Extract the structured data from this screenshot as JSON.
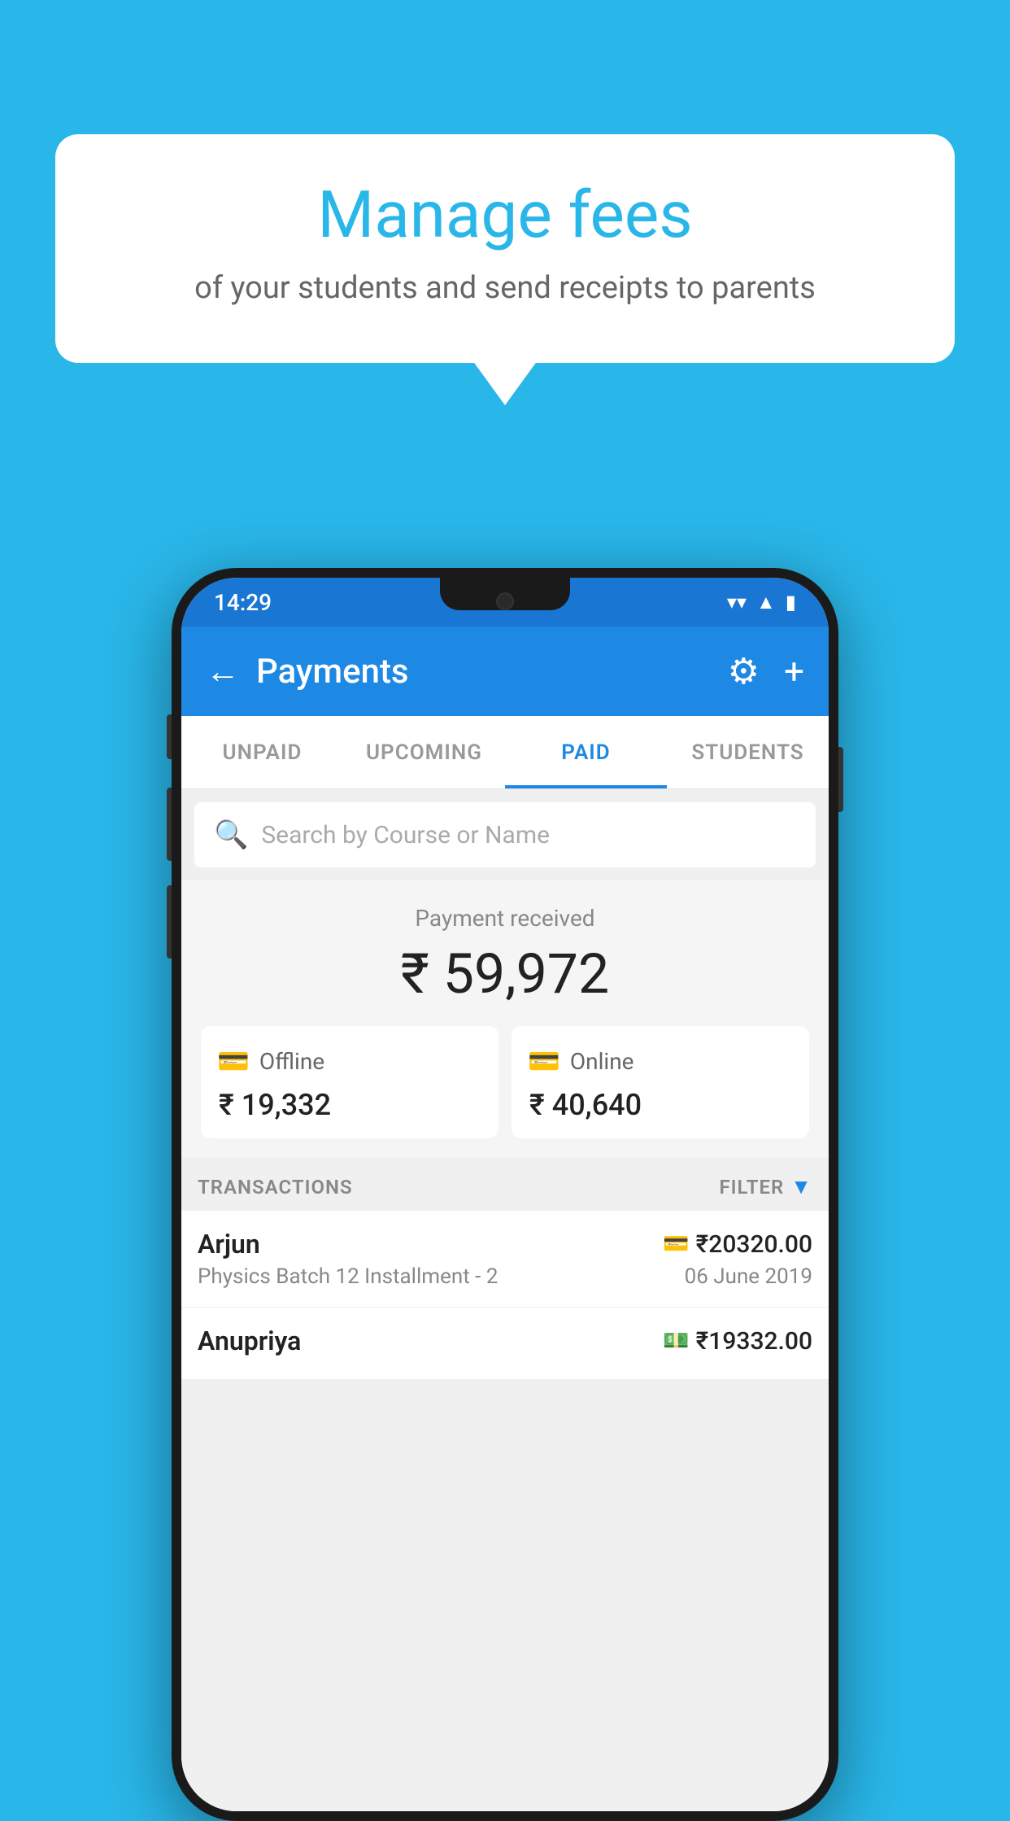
{
  "page": {
    "background_color": "#29b6e8"
  },
  "bubble": {
    "title": "Manage fees",
    "subtitle": "of your students and send receipts to parents"
  },
  "status_bar": {
    "time": "14:29",
    "wifi_icon": "▼",
    "signal_icon": "▲",
    "battery_icon": "▮"
  },
  "header": {
    "title": "Payments",
    "back_label": "←",
    "gear_label": "⚙",
    "plus_label": "+"
  },
  "tabs": [
    {
      "id": "unpaid",
      "label": "UNPAID",
      "active": false
    },
    {
      "id": "upcoming",
      "label": "UPCOMING",
      "active": false
    },
    {
      "id": "paid",
      "label": "PAID",
      "active": true
    },
    {
      "id": "students",
      "label": "STUDENTS",
      "active": false
    }
  ],
  "search": {
    "placeholder": "Search by Course or Name"
  },
  "payment_summary": {
    "label": "Payment received",
    "total": "₹ 59,972",
    "offline_label": "Offline",
    "offline_amount": "₹ 19,332",
    "online_label": "Online",
    "online_amount": "₹ 40,640"
  },
  "transactions": {
    "section_label": "TRANSACTIONS",
    "filter_label": "FILTER",
    "items": [
      {
        "name": "Arjun",
        "course": "Physics Batch 12 Installment - 2",
        "amount": "₹20320.00",
        "date": "06 June 2019",
        "payment_type": "card"
      },
      {
        "name": "Anupriya",
        "course": "",
        "amount": "₹19332.00",
        "date": "",
        "payment_type": "cash"
      }
    ]
  }
}
